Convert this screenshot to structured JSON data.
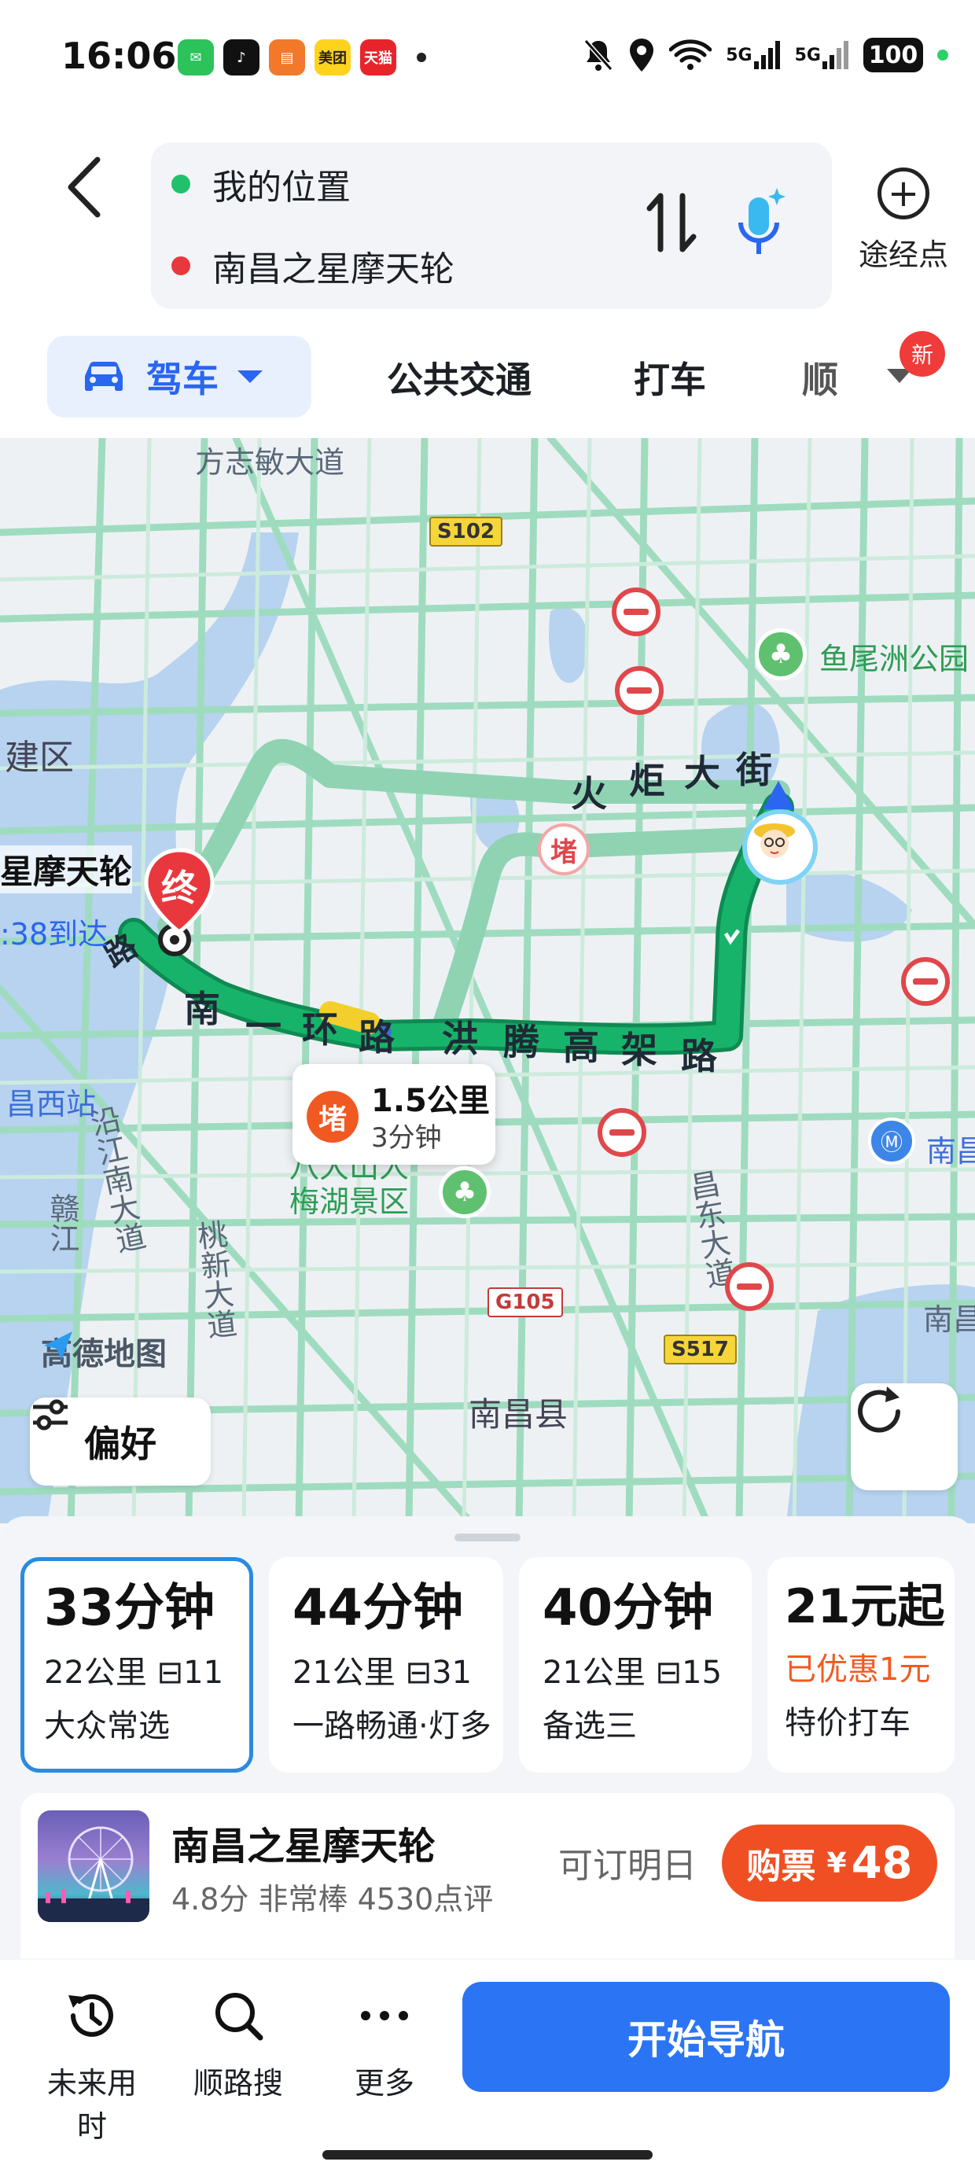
{
  "status_bar": {
    "time": "16:06",
    "apps": [
      {
        "name": "wechat-icon",
        "color": "#2bc35a",
        "glyph": "✉"
      },
      {
        "name": "tiktok-icon",
        "color": "#111111",
        "glyph": "♪"
      },
      {
        "name": "books-icon",
        "color": "#f2792a",
        "glyph": "▤"
      },
      {
        "name": "meituan-icon",
        "color": "#ffd21e",
        "glyph": "美团"
      },
      {
        "name": "tmall-icon",
        "color": "#e8242b",
        "glyph": "天猫"
      }
    ],
    "network_1": "5G",
    "network_2": "5G",
    "battery": "100"
  },
  "header": {
    "origin": "我的位置",
    "destination": "南昌之星摩天轮",
    "origin_color": "#21c16b",
    "destination_color": "#e8383d",
    "waypoint_label": "途经点",
    "waypoint_glyph": "+"
  },
  "tabs": {
    "drive": "驾车",
    "transit": "公共交通",
    "taxi": "打车",
    "carpool": "顺",
    "new_badge": "新",
    "accent_color": "#2a66f0"
  },
  "map": {
    "labels": {
      "fangzhimin": "方志敏大道",
      "jianqu": "建区",
      "yuweizhou": "鱼尾洲公园",
      "nanchang_west": "昌西站",
      "nanchang_east": "南昌",
      "nanchang_east2": "南昌",
      "bada": "八大山人\n梅湖景区",
      "nanchangxian": "南昌县",
      "yanjiang": "沿江南大道",
      "ganjiang": "赣江",
      "taoxin": "桃新大道",
      "changdong": "昌东大道"
    },
    "road_codes": {
      "s102": "S102",
      "g105": "G105",
      "s517": "S517"
    },
    "street_chars": {
      "huoju": [
        "火",
        "炬",
        "大",
        "街"
      ],
      "nanyihuan": [
        "南",
        "一",
        "环",
        "路"
      ],
      "honteng": [
        "洪",
        "腾",
        "高",
        "架",
        "路"
      ],
      "lu": "路"
    },
    "destination_label": "星摩天轮",
    "destination_eta": ":38到达",
    "destination_pin_text": "终",
    "jam_chip": "堵",
    "jam_card": {
      "icon": "堵",
      "distance": "1.5公里",
      "time": "3分钟"
    },
    "logo": "高德地图",
    "preference_btn": "偏好",
    "route_color": "#18b36b",
    "alt_route_color": "#8fd3b3"
  },
  "routes": [
    {
      "time": "33分钟",
      "dist": "22公里",
      "lights": "11",
      "tag": "大众常选",
      "selected": true
    },
    {
      "time": "44分钟",
      "dist": "21公里",
      "lights": "31",
      "tag": "一路畅通·灯多",
      "selected": false
    },
    {
      "time": "40分钟",
      "dist": "21公里",
      "lights": "15",
      "tag": "备选三",
      "selected": false
    }
  ],
  "taxi_card": {
    "price": "21元起",
    "discount": "已优惠1元",
    "tag": "特价打车"
  },
  "poi": {
    "name": "南昌之星摩天轮",
    "meta": "4.8分  非常棒  4530点评",
    "book": "可订明日",
    "buy_label": "购票",
    "currency": "¥",
    "price": "48"
  },
  "actions": {
    "future": "未来用时",
    "along": "顺路搜",
    "more": "更多",
    "navigate": "开始导航"
  }
}
